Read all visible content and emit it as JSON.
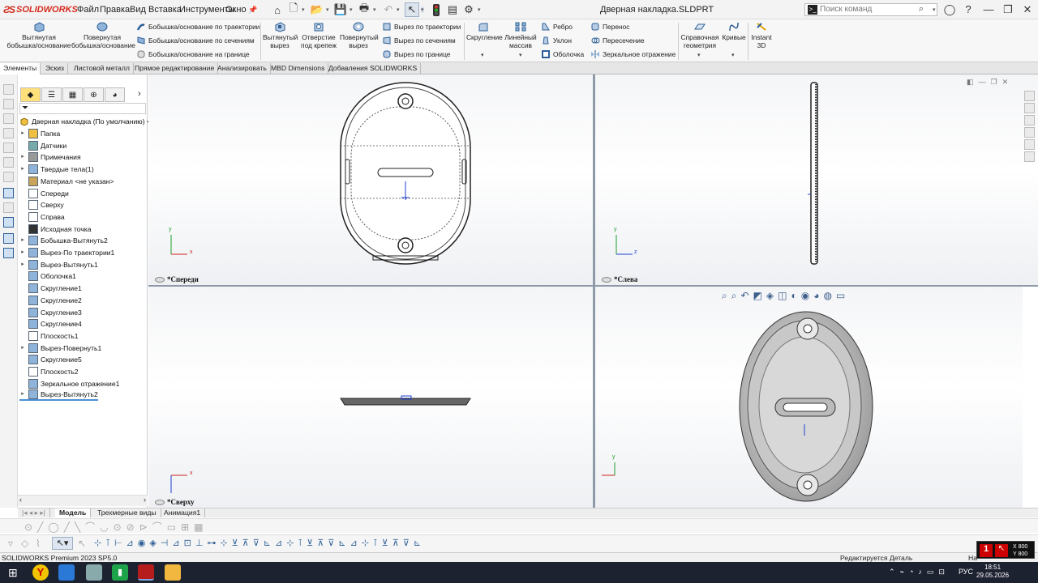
{
  "app": {
    "name": "SOLIDWORKS",
    "document_title": "Дверная накладка.SLDPRT",
    "edition": "SOLIDWORKS Premium 2023 SP5.0"
  },
  "menu": [
    "Файл",
    "Правка",
    "Вид",
    "Вставка",
    "Инструменты",
    "Окно"
  ],
  "search": {
    "placeholder": "Поиск команд"
  },
  "command_manager": {
    "tools": {
      "extrude_boss": "Вытянутая\nбобышка/основание",
      "revolve_boss": "Повернутая\nбобышка/основание",
      "sweep_boss": "Бобышка/основание по траектории",
      "loft_boss": "Бобышка/основание по сечениям",
      "boundary_boss": "Бобышка/основание на границе",
      "extrude_cut": "Вытянутый\nвырез",
      "hole_wizard": "Отверстие\nпод крепеж",
      "revolve_cut": "Повернутый\nвырез",
      "sweep_cut": "Вырез по траектории",
      "loft_cut": "Вырез по сечениям",
      "boundary_cut": "Вырез по границе",
      "fillet": "Скругление",
      "linear_pattern": "Линейный\nмассив",
      "rib": "Ребро",
      "draft": "Уклон",
      "shell": "Оболочка",
      "wrap": "Перенос",
      "intersect": "Пересечение",
      "mirror": "Зеркальное отражение",
      "ref_geometry": "Справочная\nгеометрия",
      "curves": "Кривые",
      "instant3d": "Instant\n3D"
    }
  },
  "tabs": [
    "Элементы",
    "Эскиз",
    "Листовой металл",
    "Прямое редактирование",
    "Анализировать",
    "MBD Dimensions",
    "Добавления SOLIDWORKS"
  ],
  "feature_tree": {
    "root": "Дверная накладка  (По умолчанию) <<",
    "items": [
      {
        "label": "Папка",
        "expandable": true,
        "icon": "folder-icon"
      },
      {
        "label": "Датчики",
        "expandable": false,
        "icon": "sensor-icon"
      },
      {
        "label": "Примечания",
        "expandable": true,
        "icon": "annotation-icon"
      },
      {
        "label": "Твердые тела(1)",
        "expandable": true,
        "icon": "solid-bodies-icon"
      },
      {
        "label": "Материал <не указан>",
        "expandable": false,
        "icon": "material-icon"
      },
      {
        "label": "Спереди",
        "expandable": false,
        "icon": "plane-icon"
      },
      {
        "label": "Сверху",
        "expandable": false,
        "icon": "plane-icon"
      },
      {
        "label": "Справа",
        "expandable": false,
        "icon": "plane-icon"
      },
      {
        "label": "Исходная точка",
        "expandable": false,
        "icon": "origin-icon"
      },
      {
        "label": "Бобышка-Вытянуть2",
        "expandable": true,
        "icon": "extrude-icon"
      },
      {
        "label": "Вырез-По траектории1",
        "expandable": true,
        "icon": "sweep-cut-icon"
      },
      {
        "label": "Вырез-Вытянуть1",
        "expandable": true,
        "icon": "cut-extrude-icon"
      },
      {
        "label": "Оболочка1",
        "expandable": false,
        "icon": "shell-icon"
      },
      {
        "label": "Скругление1",
        "expandable": false,
        "icon": "fillet-icon"
      },
      {
        "label": "Скругление2",
        "expandable": false,
        "icon": "fillet-icon"
      },
      {
        "label": "Скругление3",
        "expandable": false,
        "icon": "fillet-icon"
      },
      {
        "label": "Скругление4",
        "expandable": false,
        "icon": "fillet-icon"
      },
      {
        "label": "Плоскость1",
        "expandable": false,
        "icon": "plane-icon"
      },
      {
        "label": "Вырез-Повернуть1",
        "expandable": true,
        "icon": "revolve-cut-icon"
      },
      {
        "label": "Скругление5",
        "expandable": false,
        "icon": "fillet-icon"
      },
      {
        "label": "Плоскость2",
        "expandable": false,
        "icon": "plane-icon"
      },
      {
        "label": "Зеркальное отражение1",
        "expandable": false,
        "icon": "mirror-icon"
      },
      {
        "label": "Вырез-Вытянуть2",
        "expandable": true,
        "icon": "cut-extrude-icon"
      }
    ]
  },
  "viewports": {
    "front": "*Спереди",
    "left": "*Слева",
    "top": "*Сверху"
  },
  "axes": {
    "x": "x",
    "y": "y",
    "z": "z"
  },
  "bottom_tabs": [
    "Модель",
    "Трехмерные виды",
    "Анимация1"
  ],
  "status": {
    "editing": "Редактируется Деталь",
    "right": "На"
  },
  "coord": {
    "x": "X 800",
    "y": "Y 800"
  },
  "taskbar": {
    "lang": "РУС",
    "time": "18:51",
    "date": "29.05.2026"
  },
  "colors": {
    "accent": "#d52b1e",
    "selection": "#4a90d9",
    "taskbar": "#1c2230"
  }
}
